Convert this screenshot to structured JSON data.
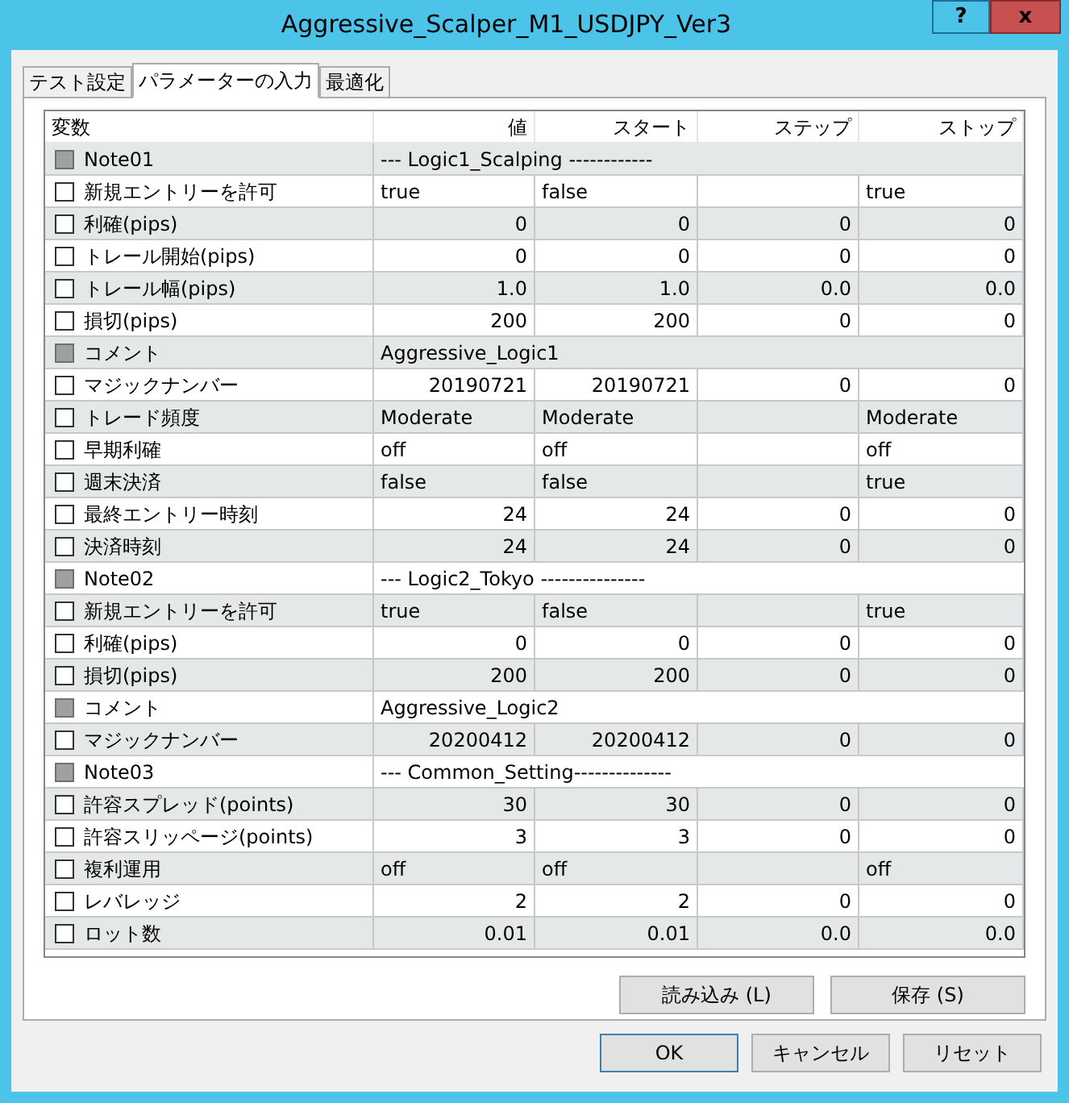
{
  "window": {
    "title": "Aggressive_Scalper_M1_USDJPY_Ver3",
    "help_button": "?",
    "close_button": "x"
  },
  "tabs": [
    {
      "label": "テスト設定",
      "selected": false
    },
    {
      "label": "パラメーターの入力",
      "selected": true
    },
    {
      "label": "最適化",
      "selected": false
    }
  ],
  "table": {
    "columns": [
      "変数",
      "値",
      "スタート",
      "ステップ",
      "ストップ"
    ],
    "rows": [
      {
        "kind": "note",
        "name": "Note01",
        "disabled": true,
        "checked": false,
        "value": "--- Logic1_Scalping ------------"
      },
      {
        "kind": "text",
        "name": "新規エントリーを許可",
        "disabled": false,
        "checked": false,
        "value": "true",
        "start": "false",
        "stop": "true"
      },
      {
        "kind": "number",
        "name": "利確(pips)",
        "disabled": false,
        "checked": false,
        "value": "0",
        "start": "0",
        "step": "0",
        "stop": "0"
      },
      {
        "kind": "number",
        "name": "トレール開始(pips)",
        "disabled": false,
        "checked": false,
        "value": "0",
        "start": "0",
        "step": "0",
        "stop": "0"
      },
      {
        "kind": "number",
        "name": "トレール幅(pips)",
        "disabled": false,
        "checked": false,
        "value": "1.0",
        "start": "1.0",
        "step": "0.0",
        "stop": "0.0"
      },
      {
        "kind": "number",
        "name": "損切(pips)",
        "disabled": false,
        "checked": false,
        "value": "200",
        "start": "200",
        "step": "0",
        "stop": "0"
      },
      {
        "kind": "note",
        "name": "コメント",
        "disabled": true,
        "checked": false,
        "value": "Aggressive_Logic1"
      },
      {
        "kind": "number",
        "name": "マジックナンバー",
        "disabled": false,
        "checked": false,
        "value": "20190721",
        "start": "20190721",
        "step": "0",
        "stop": "0"
      },
      {
        "kind": "text",
        "name": "トレード頻度",
        "disabled": false,
        "checked": false,
        "value": "Moderate",
        "start": "Moderate",
        "stop": "Moderate"
      },
      {
        "kind": "text",
        "name": "早期利確",
        "disabled": false,
        "checked": false,
        "value": "off",
        "start": "off",
        "stop": "off"
      },
      {
        "kind": "text",
        "name": "週末決済",
        "disabled": false,
        "checked": false,
        "value": "false",
        "start": "false",
        "stop": "true"
      },
      {
        "kind": "number",
        "name": "最終エントリー時刻",
        "disabled": false,
        "checked": false,
        "value": "24",
        "start": "24",
        "step": "0",
        "stop": "0"
      },
      {
        "kind": "number",
        "name": "決済時刻",
        "disabled": false,
        "checked": false,
        "value": "24",
        "start": "24",
        "step": "0",
        "stop": "0"
      },
      {
        "kind": "note",
        "name": "Note02",
        "disabled": true,
        "checked": false,
        "value": "--- Logic2_Tokyo ---------------"
      },
      {
        "kind": "text",
        "name": "新規エントリーを許可",
        "disabled": false,
        "checked": false,
        "value": "true",
        "start": "false",
        "stop": "true"
      },
      {
        "kind": "number",
        "name": "利確(pips)",
        "disabled": false,
        "checked": false,
        "value": "0",
        "start": "0",
        "step": "0",
        "stop": "0"
      },
      {
        "kind": "number",
        "name": "損切(pips)",
        "disabled": false,
        "checked": false,
        "value": "200",
        "start": "200",
        "step": "0",
        "stop": "0"
      },
      {
        "kind": "note",
        "name": "コメント",
        "disabled": true,
        "checked": false,
        "value": "Aggressive_Logic2"
      },
      {
        "kind": "number",
        "name": "マジックナンバー",
        "disabled": false,
        "checked": false,
        "value": "20200412",
        "start": "20200412",
        "step": "0",
        "stop": "0"
      },
      {
        "kind": "note",
        "name": "Note03",
        "disabled": true,
        "checked": false,
        "value": "--- Common_Setting--------------"
      },
      {
        "kind": "number",
        "name": "許容スプレッド(points)",
        "disabled": false,
        "checked": false,
        "value": "30",
        "start": "30",
        "step": "0",
        "stop": "0"
      },
      {
        "kind": "number",
        "name": "許容スリッページ(points)",
        "disabled": false,
        "checked": false,
        "value": "3",
        "start": "3",
        "step": "0",
        "stop": "0"
      },
      {
        "kind": "text",
        "name": "複利運用",
        "disabled": false,
        "checked": false,
        "value": "off",
        "start": "off",
        "stop": "off"
      },
      {
        "kind": "number",
        "name": "レバレッジ",
        "disabled": false,
        "checked": false,
        "value": "2",
        "start": "2",
        "step": "0",
        "stop": "0"
      },
      {
        "kind": "number",
        "name": "ロット数",
        "disabled": false,
        "checked": false,
        "value": "0.01",
        "start": "0.01",
        "step": "0.0",
        "stop": "0.0"
      }
    ]
  },
  "panel_buttons": [
    "読み込み (L)",
    "保存 (S)"
  ],
  "dialog_buttons": [
    {
      "label": "OK",
      "default": true
    },
    {
      "label": "キャンセル",
      "default": false
    },
    {
      "label": "リセット",
      "default": false
    }
  ]
}
